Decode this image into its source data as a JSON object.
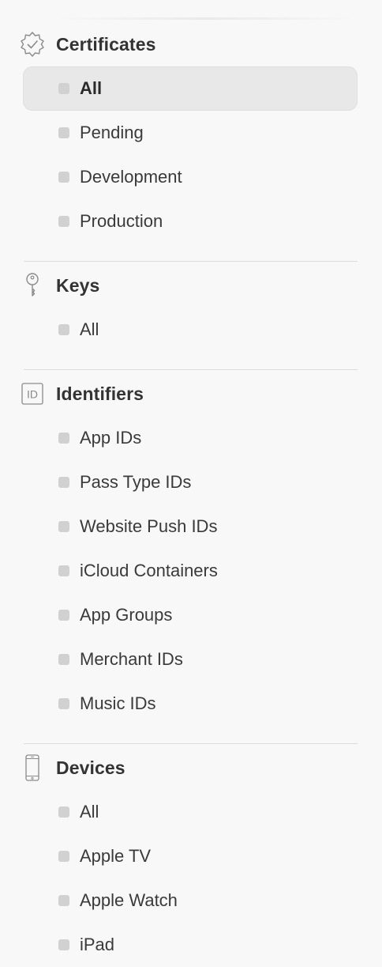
{
  "sections": {
    "certificates": {
      "title": "Certificates",
      "icon": "certificate-seal-icon",
      "items": [
        {
          "label": "All",
          "selected": true
        },
        {
          "label": "Pending",
          "selected": false
        },
        {
          "label": "Development",
          "selected": false
        },
        {
          "label": "Production",
          "selected": false
        }
      ]
    },
    "keys": {
      "title": "Keys",
      "icon": "key-icon",
      "items": [
        {
          "label": "All",
          "selected": false
        }
      ]
    },
    "identifiers": {
      "title": "Identifiers",
      "icon": "id-badge-icon",
      "icon_text": "ID",
      "items": [
        {
          "label": "App IDs",
          "selected": false
        },
        {
          "label": "Pass Type IDs",
          "selected": false
        },
        {
          "label": "Website Push IDs",
          "selected": false
        },
        {
          "label": "iCloud Containers",
          "selected": false
        },
        {
          "label": "App Groups",
          "selected": false
        },
        {
          "label": "Merchant IDs",
          "selected": false
        },
        {
          "label": "Music IDs",
          "selected": false
        }
      ]
    },
    "devices": {
      "title": "Devices",
      "icon": "phone-icon",
      "items": [
        {
          "label": "All",
          "selected": false
        },
        {
          "label": "Apple TV",
          "selected": false
        },
        {
          "label": "Apple Watch",
          "selected": false
        },
        {
          "label": "iPad",
          "selected": false
        }
      ]
    }
  },
  "colors": {
    "background": "#f7f8f7",
    "selected_background": "#e8e8e8",
    "bullet": "#d1d1d1",
    "divider": "#dcdcdc",
    "text": "#333333",
    "icon_stroke": "#8a8a8a"
  }
}
